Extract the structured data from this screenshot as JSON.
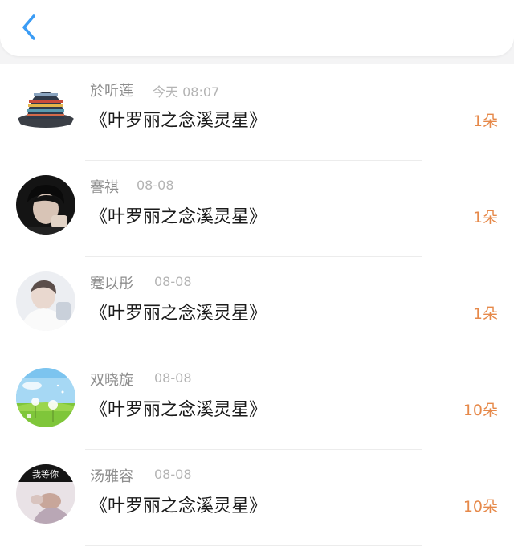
{
  "header": {
    "back_icon": "back-chevron-icon",
    "accent": "#3b9cf5"
  },
  "list": {
    "items": [
      {
        "name": "於听莲",
        "time": "今天 08:07",
        "title": "《叶罗丽之念溪灵星》",
        "count": "1朵",
        "avatar": "bucket-hat-avatar"
      },
      {
        "name": "謇祺",
        "time": "08-08",
        "title": "《叶罗丽之念溪灵星》",
        "count": "1朵",
        "avatar": "boy-portrait-avatar"
      },
      {
        "name": "蹇以彤",
        "time": "08-08",
        "title": "《叶罗丽之念溪灵星》",
        "count": "1朵",
        "avatar": "boy-light-avatar"
      },
      {
        "name": "双晓旋",
        "time": "08-08",
        "title": "《叶罗丽之念溪灵星》",
        "count": "10朵",
        "avatar": "dandelion-field-avatar"
      },
      {
        "name": "汤雅容",
        "time": "08-08",
        "title": "《叶罗丽之念溪灵星》",
        "count": "10朵",
        "avatar": "text-photo-avatar",
        "avatar_text": "我等你"
      }
    ],
    "count_color": "#e6894a"
  }
}
